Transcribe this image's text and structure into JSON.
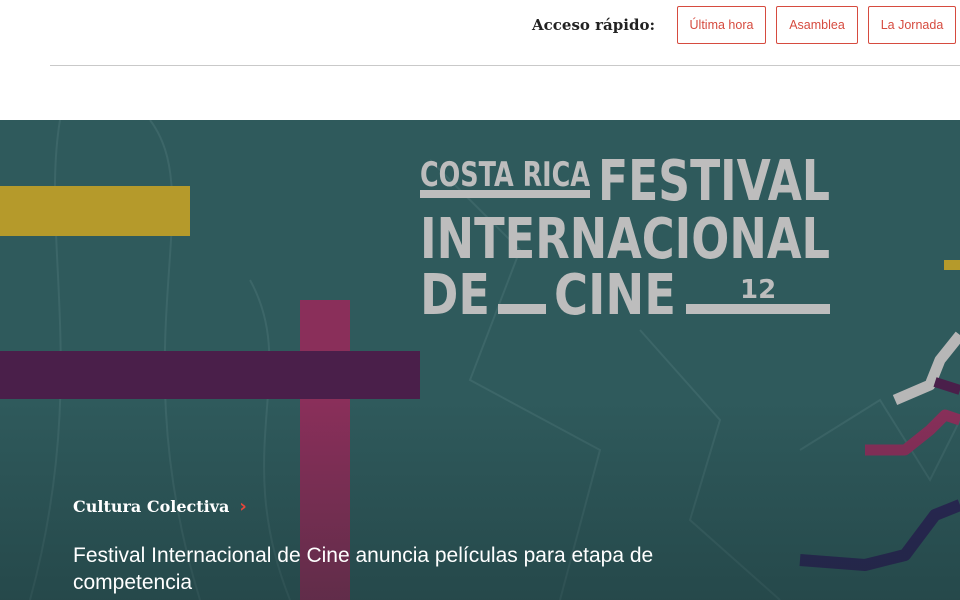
{
  "quick_access": {
    "label": "Acceso rápido:",
    "buttons": [
      "Última hora",
      "Asamblea",
      "La Jornada"
    ]
  },
  "hero": {
    "poster": {
      "line1_small": "COSTA RICA",
      "line1_big": "FESTIVAL",
      "line2": "INTERNACIONAL",
      "line3": "DE",
      "line3b": "CINE",
      "edition": "12"
    },
    "category": "Cultura Colectiva",
    "headline": "Festival Internacional de Cine anuncia películas para etapa de competencia"
  },
  "icons": {
    "category_chevron": "chevron-right-icon"
  },
  "colors": {
    "accent": "#d64b3f",
    "hero_bg": "#2f5a5c",
    "yellow_bar": "#b59a2b",
    "purple_bar": "#4a1f4a",
    "magenta_bar": "#8a2f5a"
  }
}
